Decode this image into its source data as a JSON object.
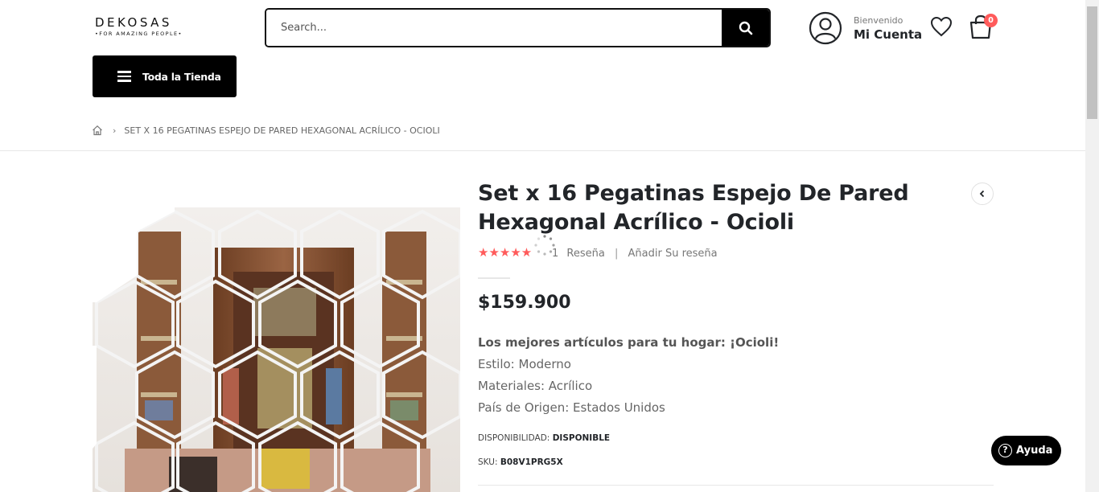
{
  "header": {
    "logo_main": "DEKOSAS",
    "logo_sub": "FOR AMAZING PEOPLE",
    "search_placeholder": "Search...",
    "welcome": "Bienvenido",
    "account": "Mi Cuenta",
    "cart_count": "0",
    "menu_label": "Toda la Tienda"
  },
  "breadcrumb": {
    "current": "SET X 16 PEGATINAS ESPEJO DE PARED HEXAGONAL ACRÍLICO - OCIOLI"
  },
  "product": {
    "title": "Set x 16 Pegatinas Espejo De Pared Hexagonal Acrílico - Ocioli",
    "rating": 5,
    "stars": "★★★★★",
    "review_count": "1",
    "review_label": "Reseña",
    "add_review": "Añadir Su reseña",
    "price": "$159.900",
    "desc_headline": "Los mejores artículos para tu hogar: ¡Ocioli!",
    "desc_lines": [
      "Estilo: Moderno",
      "Materiales: Acrílico",
      "País de Origen: Estados Unidos"
    ],
    "availability_label": "DISPONIBILIDAD:",
    "availability_value": "DISPONIBLE",
    "sku_label": "SKU:",
    "sku_value": "B08V1PRG5X"
  },
  "help": {
    "label": "Ayuda"
  },
  "colors": {
    "accent": "#ff5b5b",
    "primary": "#000000",
    "text": "#222529"
  }
}
